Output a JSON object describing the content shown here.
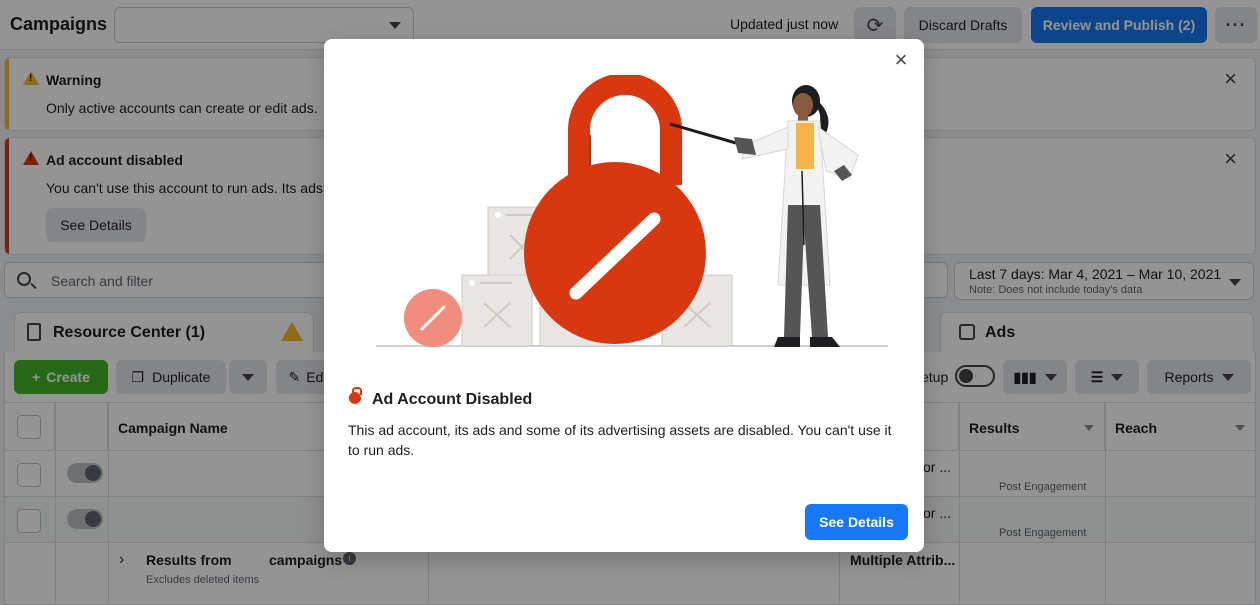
{
  "topbar": {
    "title": "Campaigns",
    "updated": "Updated just now",
    "discard_label": "Discard Drafts",
    "publish_label": "Review and Publish (2)",
    "more_label": "···"
  },
  "banners": {
    "warning": {
      "title": "Warning",
      "text": "Only active accounts can create or edit ads."
    },
    "disabled": {
      "title": "Ad account disabled",
      "text": "You can't use this account to run ads. Its ads",
      "button": "See Details"
    }
  },
  "search": {
    "placeholder": "Search and filter"
  },
  "daterange": {
    "label": "Last 7 days: Mar 4, 2021 – Mar 10, 2021",
    "note": "Note: Does not include today's data"
  },
  "tabs": {
    "resource_center": "Resource Center (1)",
    "ads": "Ads"
  },
  "toolbar": {
    "create": "Create",
    "duplicate": "Duplicate",
    "edit": "Ed",
    "setup": "etup",
    "reports": "Reports"
  },
  "table": {
    "headers": {
      "campaign_name": "Campaign Name",
      "results": "Results",
      "reach": "Reach"
    },
    "rows": [
      {
        "attr": "or ...",
        "results_sub": "Post Engagement"
      },
      {
        "attr": "or ...",
        "results_sub": "Post Engagement"
      }
    ],
    "summary": {
      "title_a": "Results from",
      "title_b": "campaigns",
      "sub": "Excludes deleted items",
      "attribution": "Multiple Attrib..."
    }
  },
  "modal": {
    "title": "Ad Account Disabled",
    "text": "This ad account, its ads and some of its advertising assets are disabled. You can't use it to run ads.",
    "button": "See Details",
    "close": "×"
  },
  "colors": {
    "primary": "#1877f2",
    "create_green": "#42b72a",
    "warning_yellow": "#f7b928",
    "error_red": "#d8380f"
  }
}
